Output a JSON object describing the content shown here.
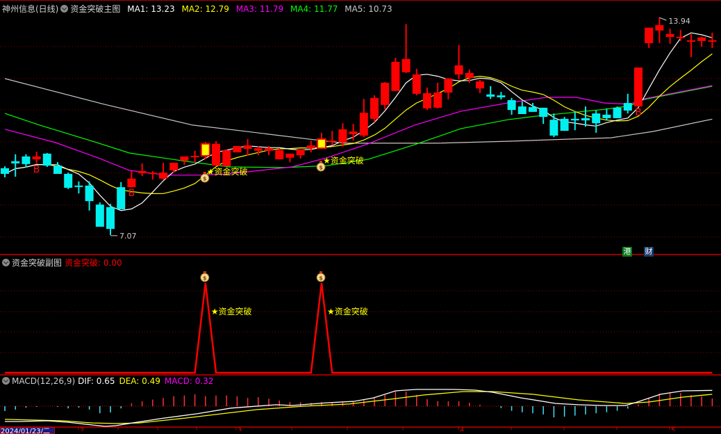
{
  "header": {
    "stock": "神州信息(日线)",
    "indicator": "资金突破主图",
    "ma": [
      {
        "label": "MA1: 13.23",
        "color": "#ffffff"
      },
      {
        "label": "MA2: 12.79",
        "color": "#ffff00"
      },
      {
        "label": "MA3: 11.79",
        "color": "#ff00ff"
      },
      {
        "label": "MA4: 11.77",
        "color": "#00ff00"
      },
      {
        "label": "MA5: 10.73",
        "color": "#c8c8c8"
      }
    ]
  },
  "sub_header": {
    "title": "资金突破副图",
    "value": "资金突破: 0.00"
  },
  "macd_header": {
    "title": "MACD(12,26,9)",
    "dif": "DIF: 0.65",
    "dea": "DEA: 0.49",
    "macd": "MACD: 0.32"
  },
  "badges": {
    "hk": "港",
    "fin": "财"
  },
  "axis": {
    "date": "2024/01/23/二",
    "labels": [
      "2",
      "3",
      "4",
      "5"
    ]
  },
  "annotations": {
    "high": "13.94",
    "low": "7.07",
    "signal_text": "★资金突破",
    "buy": "B"
  },
  "colors": {
    "up": "#ff0000",
    "down": "#00f0f0",
    "highlight": "#ffff00",
    "grid": "#8b0000"
  },
  "chart_data": {
    "type": "candlestick",
    "price_range": [
      7,
      13.94
    ],
    "candles": [
      [
        9.18,
        9.24,
        8.89,
        9.0
      ],
      [
        9.4,
        9.62,
        8.91,
        9.33
      ],
      [
        9.55,
        9.62,
        9.2,
        9.31
      ],
      [
        9.46,
        9.7,
        9.33,
        9.55
      ],
      [
        9.64,
        9.66,
        9.22,
        9.26
      ],
      [
        9.26,
        9.37,
        9.0,
        9.0
      ],
      [
        9.0,
        9.04,
        8.52,
        8.56
      ],
      [
        8.63,
        8.76,
        8.38,
        8.6
      ],
      [
        8.63,
        8.76,
        7.84,
        8.14
      ],
      [
        8.03,
        8.1,
        7.33,
        7.33
      ],
      [
        7.95,
        8.05,
        7.07,
        7.26
      ],
      [
        8.58,
        8.74,
        7.88,
        7.88
      ],
      [
        8.58,
        9.09,
        8.58,
        8.85
      ],
      [
        9.02,
        9.33,
        8.93,
        9.09
      ],
      [
        9.0,
        9.09,
        8.82,
        9.04
      ],
      [
        8.85,
        9.35,
        8.82,
        9.04
      ],
      [
        9.11,
        9.35,
        9.04,
        9.35
      ],
      [
        9.42,
        9.55,
        9.29,
        9.55
      ],
      [
        9.53,
        9.73,
        9.35,
        9.57
      ],
      [
        9.57,
        10.01,
        9.46,
        9.95
      ],
      [
        9.26,
        10.03,
        9.26,
        9.95
      ],
      [
        9.24,
        9.77,
        9.24,
        9.75
      ],
      [
        9.68,
        9.88,
        9.68,
        9.88
      ],
      [
        9.79,
        10.1,
        9.57,
        9.9
      ],
      [
        9.73,
        9.88,
        9.59,
        9.81
      ],
      [
        9.73,
        9.88,
        9.59,
        9.81
      ],
      [
        9.46,
        9.81,
        9.46,
        9.75
      ],
      [
        9.51,
        9.64,
        9.37,
        9.64
      ],
      [
        9.59,
        9.77,
        9.48,
        9.77
      ],
      [
        9.81,
        10.05,
        9.68,
        9.9
      ],
      [
        9.81,
        10.3,
        9.81,
        10.1
      ],
      [
        10.03,
        10.36,
        9.9,
        10.05
      ],
      [
        9.99,
        10.6,
        9.86,
        10.41
      ],
      [
        10.25,
        10.58,
        10.05,
        10.34
      ],
      [
        10.21,
        11.37,
        10.16,
        10.93
      ],
      [
        10.74,
        11.48,
        10.63,
        11.4
      ],
      [
        11.18,
        11.9,
        11.04,
        11.88
      ],
      [
        11.62,
        12.67,
        11.62,
        12.54
      ],
      [
        12.21,
        13.73,
        12.19,
        12.63
      ],
      [
        11.53,
        12.32,
        11.48,
        12.14
      ],
      [
        11.07,
        11.73,
        11.02,
        11.55
      ],
      [
        11.09,
        11.88,
        11.07,
        11.57
      ],
      [
        11.57,
        12.03,
        11.35,
        12.01
      ],
      [
        12.14,
        13.07,
        11.99,
        12.43
      ],
      [
        12.03,
        12.3,
        11.88,
        12.19
      ],
      [
        11.7,
        11.97,
        11.55,
        11.92
      ],
      [
        11.51,
        11.77,
        11.37,
        11.44
      ],
      [
        11.48,
        11.59,
        11.35,
        11.42
      ],
      [
        11.33,
        11.4,
        10.87,
        11.02
      ],
      [
        11.13,
        11.29,
        10.89,
        10.89
      ],
      [
        11.11,
        11.24,
        10.96,
        10.96
      ],
      [
        11.09,
        11.09,
        10.58,
        10.8
      ],
      [
        10.71,
        10.91,
        10.16,
        10.21
      ],
      [
        10.74,
        10.8,
        10.36,
        10.36
      ],
      [
        10.74,
        10.98,
        10.38,
        10.69
      ],
      [
        10.76,
        11.13,
        10.49,
        10.69
      ],
      [
        10.91,
        11.0,
        10.3,
        10.6
      ],
      [
        10.87,
        11.07,
        10.71,
        10.76
      ],
      [
        11.09,
        11.13,
        10.76,
        10.76
      ],
      [
        11.24,
        11.53,
        10.91,
        11.0
      ],
      [
        11.13,
        12.36,
        11.13,
        12.36
      ],
      [
        13.13,
        13.62,
        12.98,
        13.62
      ],
      [
        13.53,
        13.94,
        13.13,
        13.7
      ],
      [
        13.33,
        13.59,
        13.11,
        13.42
      ],
      [
        13.29,
        13.55,
        13.2,
        13.33
      ],
      [
        13.18,
        13.42,
        12.69,
        13.22
      ],
      [
        13.2,
        13.33,
        13.02,
        13.31
      ],
      [
        13.18,
        13.46,
        12.98,
        13.22
      ]
    ],
    "candle_fields": [
      "open",
      "high",
      "low",
      "close"
    ],
    "highlight_days": [
      19,
      30
    ],
    "buy_days": [
      3,
      12,
      60
    ],
    "signal_days": [
      19,
      30
    ],
    "high_day": 62,
    "low_day": 10,
    "ma_computed_periods": {
      "ma1": 5,
      "ma2": 10
    },
    "ma3": [
      [
        0,
        10.41
      ],
      [
        4.8,
        9.99
      ],
      [
        8.8,
        9.51
      ],
      [
        11.8,
        9.11
      ],
      [
        15.3,
        8.96
      ],
      [
        18.4,
        8.96
      ],
      [
        21.2,
        9.0
      ],
      [
        27.2,
        9.22
      ],
      [
        30.5,
        9.51
      ],
      [
        34.4,
        9.95
      ],
      [
        38.8,
        10.54
      ],
      [
        43.2,
        10.98
      ],
      [
        47.6,
        11.24
      ],
      [
        51.3,
        11.42
      ],
      [
        54.1,
        11.42
      ],
      [
        56.8,
        11.24
      ],
      [
        59.2,
        11.2
      ],
      [
        60.5,
        11.37
      ],
      [
        67,
        11.79
      ]
    ],
    "ma4": [
      [
        0,
        10.91
      ],
      [
        3.3,
        10.54
      ],
      [
        8.3,
        10.03
      ],
      [
        11.8,
        9.66
      ],
      [
        17.1,
        9.4
      ],
      [
        21.3,
        9.22
      ],
      [
        26.5,
        9.2
      ],
      [
        30.5,
        9.26
      ],
      [
        34.4,
        9.46
      ],
      [
        38.8,
        9.92
      ],
      [
        43.2,
        10.43
      ],
      [
        47.6,
        10.71
      ],
      [
        50.2,
        10.82
      ],
      [
        53.5,
        10.93
      ],
      [
        56.8,
        11.04
      ],
      [
        59.2,
        11.15
      ],
      [
        60.5,
        11.35
      ],
      [
        67,
        11.77
      ]
    ],
    "ma5": [
      [
        0,
        12.01
      ],
      [
        9.4,
        11.2
      ],
      [
        17.8,
        10.54
      ],
      [
        21.9,
        10.38
      ],
      [
        30,
        10.05
      ],
      [
        32.2,
        9.97
      ],
      [
        41,
        9.97
      ],
      [
        47.6,
        10.03
      ],
      [
        53.5,
        10.1
      ],
      [
        57.4,
        10.14
      ],
      [
        61.4,
        10.34
      ],
      [
        67,
        10.73
      ]
    ],
    "sub_values": [
      0,
      0,
      0,
      0,
      0,
      0,
      0,
      0,
      0,
      0,
      0,
      0,
      0,
      0,
      0,
      0,
      0,
      0,
      0,
      1,
      0,
      0,
      0,
      0,
      0,
      0,
      0,
      0,
      0,
      0,
      1,
      0,
      0,
      0,
      0,
      0,
      0,
      0,
      0,
      0,
      0,
      0,
      0,
      0,
      0,
      0,
      0,
      0,
      0,
      0,
      0,
      0,
      0,
      0,
      0,
      0,
      0,
      0,
      0,
      0,
      0,
      0,
      0,
      0,
      0,
      0,
      0,
      0
    ],
    "macd_hist": [
      -0.2,
      -0.14,
      -0.06,
      -0.03,
      0,
      -0.03,
      -0.09,
      -0.06,
      -0.14,
      -0.29,
      -0.26,
      -0.09,
      0.12,
      0.2,
      0.27,
      0.34,
      0.41,
      0.44,
      0.49,
      0.41,
      0.44,
      0.44,
      0.41,
      0.34,
      0.37,
      0.31,
      0.23,
      0.17,
      0.17,
      0.14,
      0.17,
      0.17,
      0.2,
      0.2,
      0.29,
      0.37,
      0.46,
      0.6,
      0.6,
      0.46,
      0.29,
      0.2,
      0.2,
      0.2,
      0.14,
      0.06,
      0,
      -0.08,
      -0.19,
      -0.25,
      -0.29,
      -0.34,
      -0.46,
      -0.43,
      -0.39,
      -0.34,
      -0.29,
      -0.25,
      -0.19,
      -0.1,
      0.07,
      0.35,
      0.51,
      0.54,
      0.54,
      0.45,
      0.4,
      0.32
    ],
    "dif": [
      [
        0,
        -0.63
      ],
      [
        1.5,
        -0.63
      ],
      [
        4,
        -0.6
      ],
      [
        6,
        -0.66
      ],
      [
        8.3,
        -0.77
      ],
      [
        9.5,
        -0.83
      ],
      [
        10.5,
        -0.8
      ],
      [
        12.2,
        -0.68
      ],
      [
        14.9,
        -0.5
      ],
      [
        18.2,
        -0.31
      ],
      [
        21.4,
        -0.08
      ],
      [
        25.7,
        0.06
      ],
      [
        27.2,
        0.03
      ],
      [
        30.5,
        0.14
      ],
      [
        33.1,
        0.2
      ],
      [
        34.9,
        0.34
      ],
      [
        37,
        0.63
      ],
      [
        38,
        0.66
      ],
      [
        39,
        0.69
      ],
      [
        42.5,
        0.69
      ],
      [
        44.5,
        0.66
      ],
      [
        46.2,
        0.57
      ],
      [
        48.9,
        0.34
      ],
      [
        52.2,
        0.11
      ],
      [
        54.3,
        0.06
      ],
      [
        56.6,
        0.03
      ],
      [
        58.8,
        0.03
      ],
      [
        59.9,
        0.17
      ],
      [
        62.1,
        0.49
      ],
      [
        64.2,
        0.63
      ],
      [
        67,
        0.65
      ]
    ],
    "dea": [
      [
        0,
        -0.54
      ],
      [
        5.5,
        -0.6
      ],
      [
        8.3,
        -0.69
      ],
      [
        10.5,
        -0.71
      ],
      [
        12.7,
        -0.69
      ],
      [
        17.1,
        -0.49
      ],
      [
        21.5,
        -0.26
      ],
      [
        23.9,
        -0.14
      ],
      [
        28.3,
        0
      ],
      [
        32.6,
        0.09
      ],
      [
        37,
        0.31
      ],
      [
        39.7,
        0.46
      ],
      [
        43.4,
        0.6
      ],
      [
        46.2,
        0.6
      ],
      [
        50,
        0.49
      ],
      [
        54.3,
        0.26
      ],
      [
        58.8,
        0.11
      ],
      [
        61,
        0.17
      ],
      [
        64.2,
        0.37
      ],
      [
        67,
        0.49
      ]
    ]
  }
}
